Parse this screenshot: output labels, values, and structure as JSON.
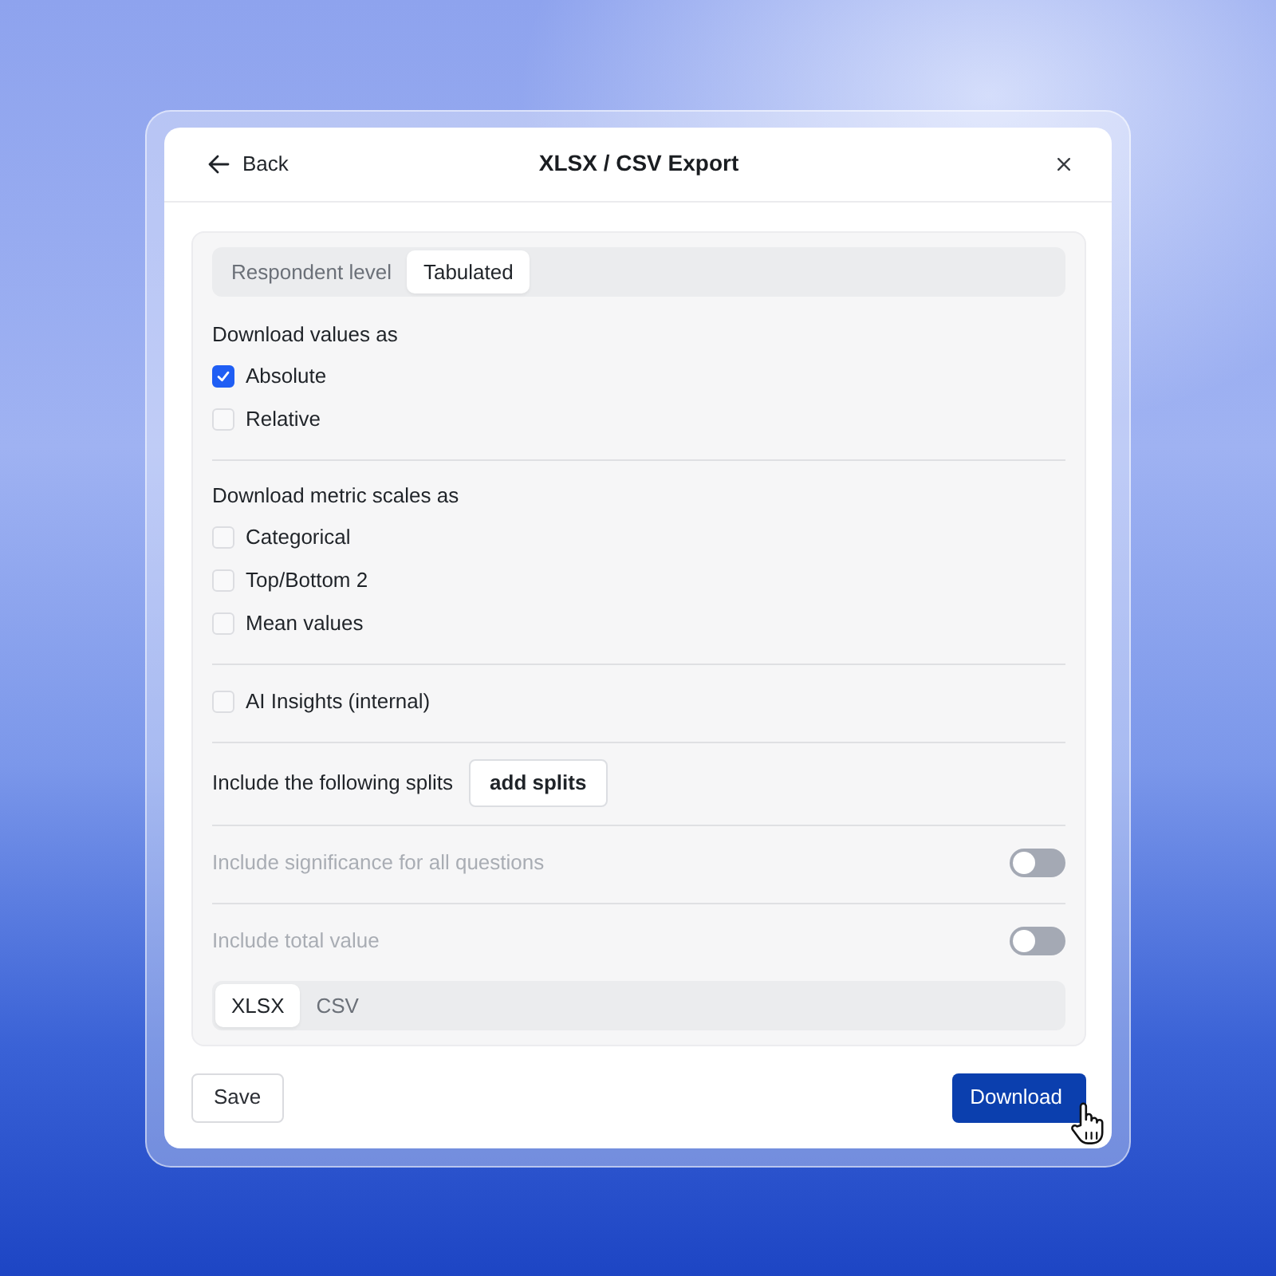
{
  "dialog": {
    "back_label": "Back",
    "title": "XLSX / CSV Export"
  },
  "level_tabs": [
    {
      "label": "Respondent level",
      "selected": false
    },
    {
      "label": "Tabulated",
      "selected": true
    }
  ],
  "sections": [
    {
      "kind": "checks",
      "heading": "Download values as",
      "options": [
        {
          "label": "Absolute",
          "checked": true
        },
        {
          "label": "Relative",
          "checked": false
        }
      ]
    },
    {
      "kind": "checks",
      "heading": "Download metric scales as",
      "options": [
        {
          "label": "Categorical",
          "checked": false
        },
        {
          "label": "Top/Bottom 2",
          "checked": false
        },
        {
          "label": "Mean values",
          "checked": false
        }
      ]
    },
    {
      "kind": "checks",
      "options": [
        {
          "label": "AI Insights (internal)",
          "checked": false
        }
      ]
    },
    {
      "kind": "button",
      "label": "Include the following splits",
      "button": "add splits"
    },
    {
      "kind": "toggle",
      "label": "Include significance for all questions",
      "on": false,
      "disabled": true
    },
    {
      "kind": "toggle",
      "label": "Include total value",
      "on": false,
      "disabled": true
    }
  ],
  "format_tabs": [
    {
      "label": "XLSX",
      "selected": true
    },
    {
      "label": "CSV",
      "selected": false
    }
  ],
  "footer": {
    "save": "Save",
    "download": "Download"
  }
}
